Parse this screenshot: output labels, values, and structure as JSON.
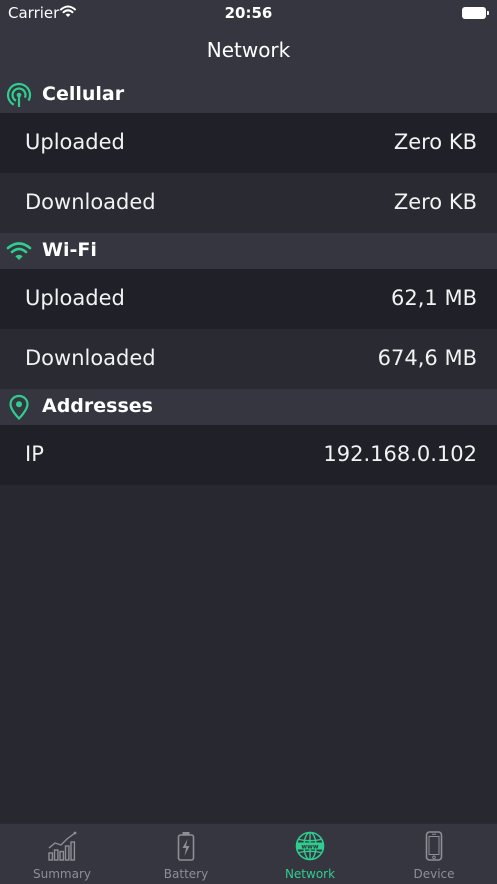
{
  "status_bar": {
    "carrier": "Carrier",
    "time": "20:56"
  },
  "nav": {
    "title": "Network"
  },
  "sections": {
    "cellular": {
      "title": "Cellular",
      "rows": [
        {
          "label": "Uploaded",
          "value": "Zero KB"
        },
        {
          "label": "Downloaded",
          "value": "Zero KB"
        }
      ]
    },
    "wifi": {
      "title": "Wi-Fi",
      "rows": [
        {
          "label": "Uploaded",
          "value": "62,1 MB"
        },
        {
          "label": "Downloaded",
          "value": "674,6 MB"
        }
      ]
    },
    "addresses": {
      "title": "Addresses",
      "rows": [
        {
          "label": "IP",
          "value": "192.168.0.102"
        }
      ]
    }
  },
  "tabbar": {
    "tabs": [
      {
        "label": "Summary",
        "icon": "bar-chart-icon"
      },
      {
        "label": "Battery",
        "icon": "battery-icon"
      },
      {
        "label": "Network",
        "icon": "globe-icon",
        "active": true
      },
      {
        "label": "Device",
        "icon": "phone-icon"
      }
    ]
  },
  "colors": {
    "accent": "#2fcd8f",
    "background": "#272830",
    "inactive": "#8e8f96"
  }
}
